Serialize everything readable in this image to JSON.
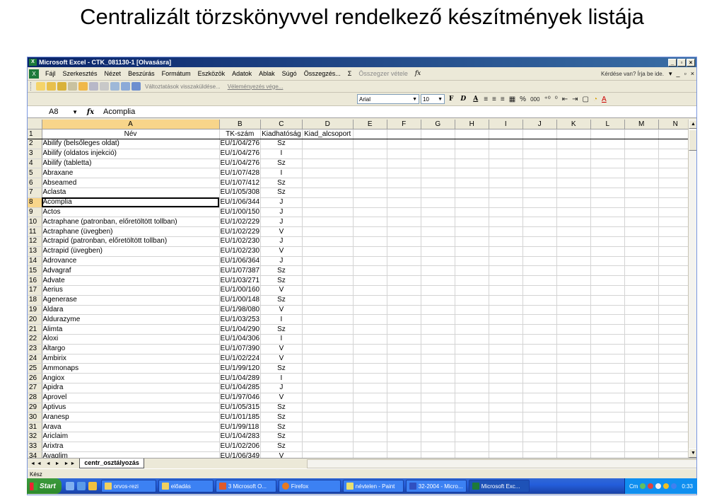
{
  "slide": {
    "title": "Centralizált törzskönyvvel rendelkező készítmények listája"
  },
  "window": {
    "title": "Microsoft Excel - CTK_081130-1 [Olvasásra]",
    "app_icon": "excel-icon"
  },
  "menu": {
    "items": [
      "Fájl",
      "Szerkesztés",
      "Nézet",
      "Beszúrás",
      "Formátum",
      "Eszközök",
      "Adatok",
      "Ablak",
      "Súgó",
      "Összegzés...",
      "Σ",
      "Összegzer vétele",
      "fx"
    ],
    "help_placeholder": "Kérdése van? Írja be ide.",
    "controls": [
      "▾",
      "_",
      "▫",
      "×"
    ]
  },
  "toolbar": {
    "track_changes": "Változtatások visszaküldése...",
    "end_review": "Véleményezés vége..."
  },
  "format_toolbar": {
    "font": "Arial",
    "size": "10",
    "bold": "F",
    "italic": "D",
    "underline": "A",
    "glyphs": [
      "≡",
      "≡",
      "≡",
      "▦",
      "%",
      "000",
      "⁺⁰",
      "⁰",
      "⇤",
      "⇥",
      "▢",
      "◔",
      "A"
    ]
  },
  "name_box": "A8",
  "formula_value": "Acomplia",
  "columns": [
    "A",
    "B",
    "C",
    "D",
    "E",
    "F",
    "G",
    "H",
    "I",
    "J",
    "K",
    "L",
    "M",
    "N"
  ],
  "header_row": {
    "num": "1",
    "cells": [
      "Név",
      "TK-szám",
      "Kiadhatóság",
      "Kiad_alcsoport"
    ]
  },
  "rows": [
    {
      "num": "2",
      "a": "Abilify (belsőleges oldat)",
      "b": "EU/1/04/276",
      "c": "Sz"
    },
    {
      "num": "3",
      "a": "Abilify (oldatos injekció)",
      "b": "EU/1/04/276",
      "c": "I"
    },
    {
      "num": "4",
      "a": "Abilify (tabletta)",
      "b": "EU/1/04/276",
      "c": "Sz"
    },
    {
      "num": "5",
      "a": "Abraxane",
      "b": "EU/1/07/428",
      "c": "I"
    },
    {
      "num": "6",
      "a": "Abseamed",
      "b": "EU/1/07/412",
      "c": "Sz"
    },
    {
      "num": "7",
      "a": "Aclasta",
      "b": "EU/1/05/308",
      "c": "Sz"
    },
    {
      "num": "8",
      "a": "Acomplia",
      "b": "EU/1/06/344",
      "c": "J"
    },
    {
      "num": "9",
      "a": "Actos",
      "b": "EU/1/00/150",
      "c": "J"
    },
    {
      "num": "10",
      "a": "Actraphane (patronban, előretöltött tollban)",
      "b": "EU/1/02/229",
      "c": "J"
    },
    {
      "num": "11",
      "a": "Actraphane (üvegben)",
      "b": "EU/1/02/229",
      "c": "V"
    },
    {
      "num": "12",
      "a": "Actrapid (patronban, előretöltött tollban)",
      "b": "EU/1/02/230",
      "c": "J"
    },
    {
      "num": "13",
      "a": "Actrapid (üvegben)",
      "b": "EU/1/02/230",
      "c": "V"
    },
    {
      "num": "14",
      "a": "Adrovance",
      "b": "EU/1/06/364",
      "c": "J"
    },
    {
      "num": "15",
      "a": "Advagraf",
      "b": "EU/1/07/387",
      "c": "Sz"
    },
    {
      "num": "16",
      "a": "Advate",
      "b": "EU/1/03/271",
      "c": "Sz"
    },
    {
      "num": "17",
      "a": "Aerius",
      "b": "EU/1/00/160",
      "c": "V"
    },
    {
      "num": "18",
      "a": "Agenerase",
      "b": "EU/1/00/148",
      "c": "Sz"
    },
    {
      "num": "19",
      "a": "Aldara",
      "b": "EU/1/98/080",
      "c": "V"
    },
    {
      "num": "20",
      "a": "Aldurazyme",
      "b": "EU/1/03/253",
      "c": "I"
    },
    {
      "num": "21",
      "a": "Alimta",
      "b": "EU/1/04/290",
      "c": "Sz"
    },
    {
      "num": "22",
      "a": "Aloxi",
      "b": "EU/1/04/306",
      "c": "I"
    },
    {
      "num": "23",
      "a": "Altargo",
      "b": "EU/1/07/390",
      "c": "V"
    },
    {
      "num": "24",
      "a": "Ambirix",
      "b": "EU/1/02/224",
      "c": "V"
    },
    {
      "num": "25",
      "a": "Ammonaps",
      "b": "EU/1/99/120",
      "c": "Sz"
    },
    {
      "num": "26",
      "a": "Angiox",
      "b": "EU/1/04/289",
      "c": "I"
    },
    {
      "num": "27",
      "a": "Apidra",
      "b": "EU/1/04/285",
      "c": "J"
    },
    {
      "num": "28",
      "a": "Aprovel",
      "b": "EU/1/97/046",
      "c": "V"
    },
    {
      "num": "29",
      "a": "Aptivus",
      "b": "EU/1/05/315",
      "c": "Sz"
    },
    {
      "num": "30",
      "a": "Aranesp",
      "b": "EU/1/01/185",
      "c": "Sz"
    },
    {
      "num": "31",
      "a": "Arava",
      "b": "EU/1/99/118",
      "c": "Sz"
    },
    {
      "num": "32",
      "a": "Ariclaim",
      "b": "EU/1/04/283",
      "c": "Sz"
    },
    {
      "num": "33",
      "a": "Arixtra",
      "b": "EU/1/02/206",
      "c": "Sz"
    },
    {
      "num": "34",
      "a": "Avaglim",
      "b": "EU/1/06/349",
      "c": "V"
    }
  ],
  "sheet_tab": "centr_osztályozás",
  "status": "Kész",
  "taskbar": {
    "start": "Start",
    "tasks": [
      "orvos-rezi",
      "előadás",
      "3 Microsoft O...",
      "Firefox",
      "névtelen - Paint",
      "32-2004 - Micro...",
      "Microsoft Exc..."
    ],
    "lang": "Cm",
    "clock": "0:33"
  }
}
